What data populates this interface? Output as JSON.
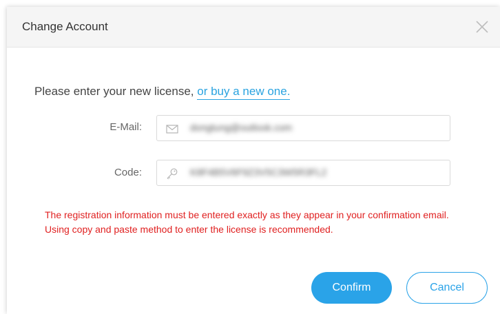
{
  "dialog": {
    "title": "Change Account",
    "close_icon": "close-x-icon"
  },
  "intro": {
    "text": "Please enter your new license,",
    "link_label": "or buy a new one."
  },
  "form": {
    "email": {
      "label": "E-Mail:",
      "icon": "envelope-icon",
      "value": "dongtung@outlook.com"
    },
    "code": {
      "label": "Code:",
      "icon": "key-icon",
      "value": "K8F4B5V6F9Z3V5C3W5R3FL2"
    }
  },
  "warning": {
    "text": "The registration information must be entered exactly as they appear in your confirmation email. Using copy and paste method to enter the license is recommended.",
    "color": "#e02020"
  },
  "buttons": {
    "confirm_label": "Confirm",
    "cancel_label": "Cancel"
  },
  "colors": {
    "accent": "#2aa3e8",
    "link": "#2aa3e0",
    "title_bar": "#f5f5f5"
  }
}
